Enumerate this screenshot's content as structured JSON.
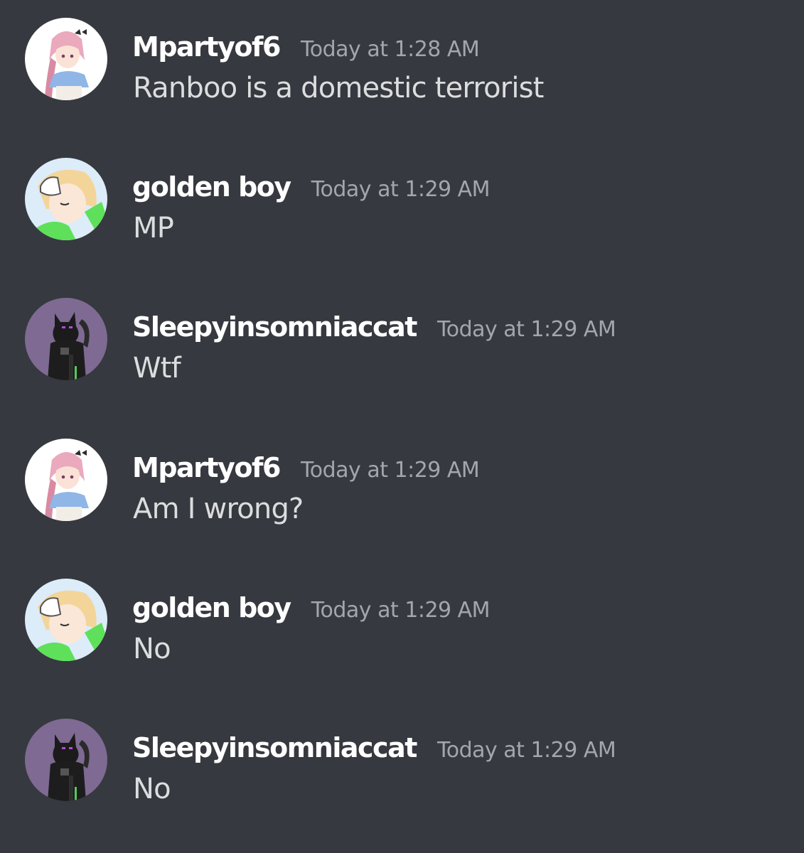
{
  "colors": {
    "background": "#36393f",
    "username": "#ffffff",
    "timestamp": "#a3a6aa",
    "message_text": "#dcddde"
  },
  "messages": [
    {
      "avatar": "avatar-mpartyof6",
      "username": "Mpartyof6",
      "timestamp": "Today at 1:28 AM",
      "content": "Ranboo is a domestic terrorist"
    },
    {
      "avatar": "avatar-golden-boy",
      "username": "golden boy",
      "timestamp": "Today at 1:29 AM",
      "content": "MP"
    },
    {
      "avatar": "avatar-sleepyinsomniaccat",
      "username": "Sleepyinsomniaccat",
      "timestamp": "Today at 1:29 AM",
      "content": "Wtf"
    },
    {
      "avatar": "avatar-mpartyof6",
      "username": "Mpartyof6",
      "timestamp": "Today at 1:29 AM",
      "content": "Am I wrong?"
    },
    {
      "avatar": "avatar-golden-boy",
      "username": "golden boy",
      "timestamp": "Today at 1:29 AM",
      "content": "No"
    },
    {
      "avatar": "avatar-sleepyinsomniaccat",
      "username": "Sleepyinsomniaccat",
      "timestamp": "Today at 1:29 AM",
      "content": "No"
    }
  ]
}
